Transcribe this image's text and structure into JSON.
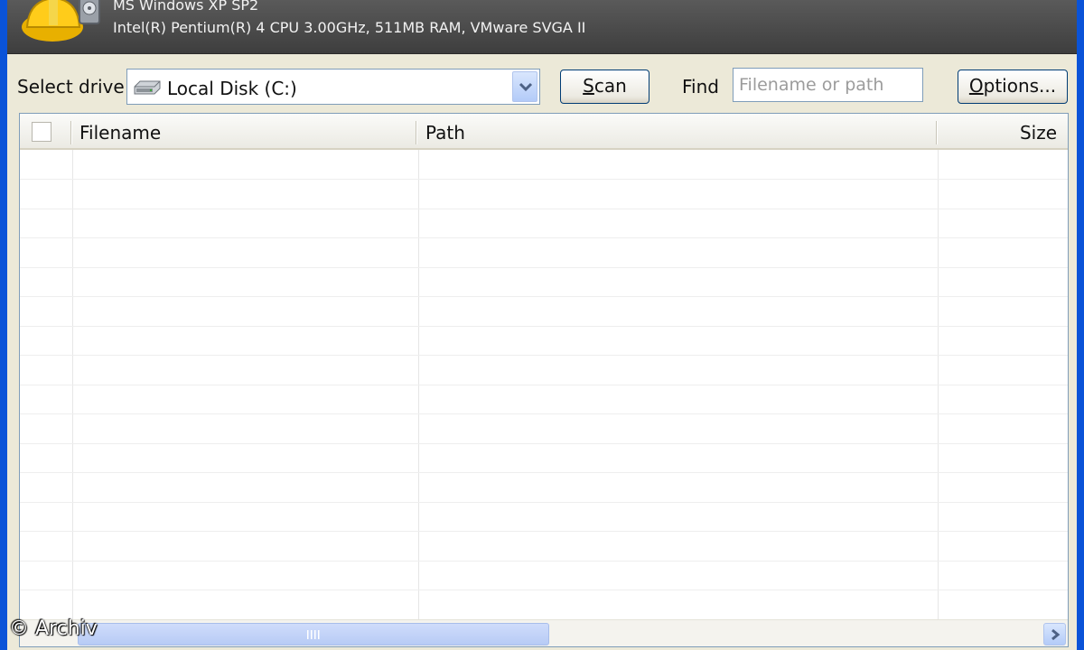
{
  "header": {
    "sysinfo_os": "MS Windows XP SP2",
    "sysinfo_hardware": "Intel(R) Pentium(R) 4 CPU 3.00GHz, 511MB RAM, VMware SVGA II",
    "app_icon": "hardhat-disk-icon"
  },
  "toolbar": {
    "select_drive_label": "Select drive",
    "drive_value": "Local Disk (C:)",
    "drive_icon": "hard-disk-icon",
    "scan_label": "Scan",
    "find_label": "Find",
    "find_placeholder": "Filename or path",
    "options_label": "Options..."
  },
  "list": {
    "columns": [
      "Filename",
      "Path",
      "Size"
    ],
    "rows": []
  },
  "watermark": "© Archiv",
  "colors": {
    "window_frame": "#0a53d8",
    "header_band": "#4a4a4a",
    "face": "#ece9d8",
    "scroll_blue": "#c2d3fa"
  }
}
